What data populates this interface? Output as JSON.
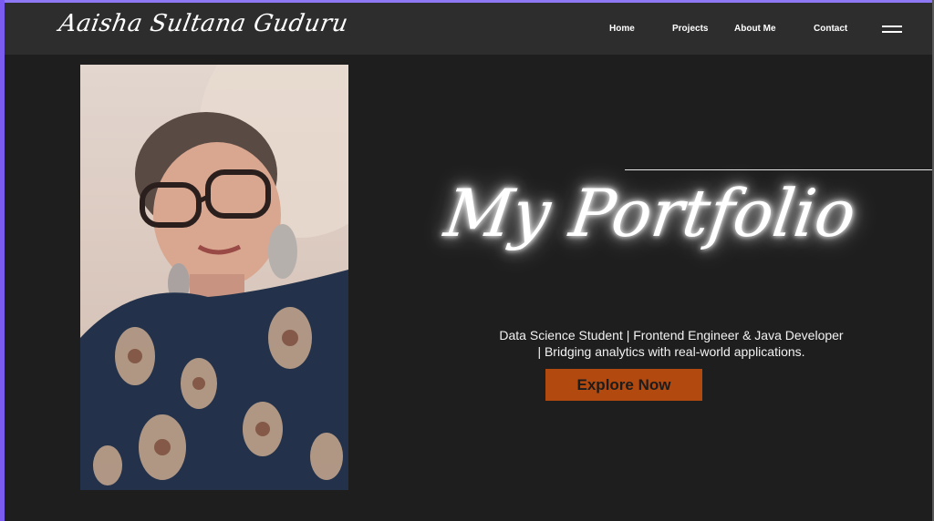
{
  "brand": {
    "name": "Aaisha Sultana Guduru"
  },
  "nav": {
    "links": [
      "Home",
      "Projects",
      "About Me",
      "Contact"
    ],
    "menu_icon": "hamburger-menu-icon"
  },
  "hero": {
    "title": "My Portfolio",
    "subtitle_line1": "Data Science Student | Frontend Engineer & Java Developer",
    "subtitle_line2": "| Bridging analytics with real-world applications.",
    "cta_label": "Explore Now"
  },
  "colors": {
    "background": "#1e1e1e",
    "navbar": "#2e2d2d",
    "cta": "#b2490f",
    "frame_accent": "#7a5cf0"
  }
}
